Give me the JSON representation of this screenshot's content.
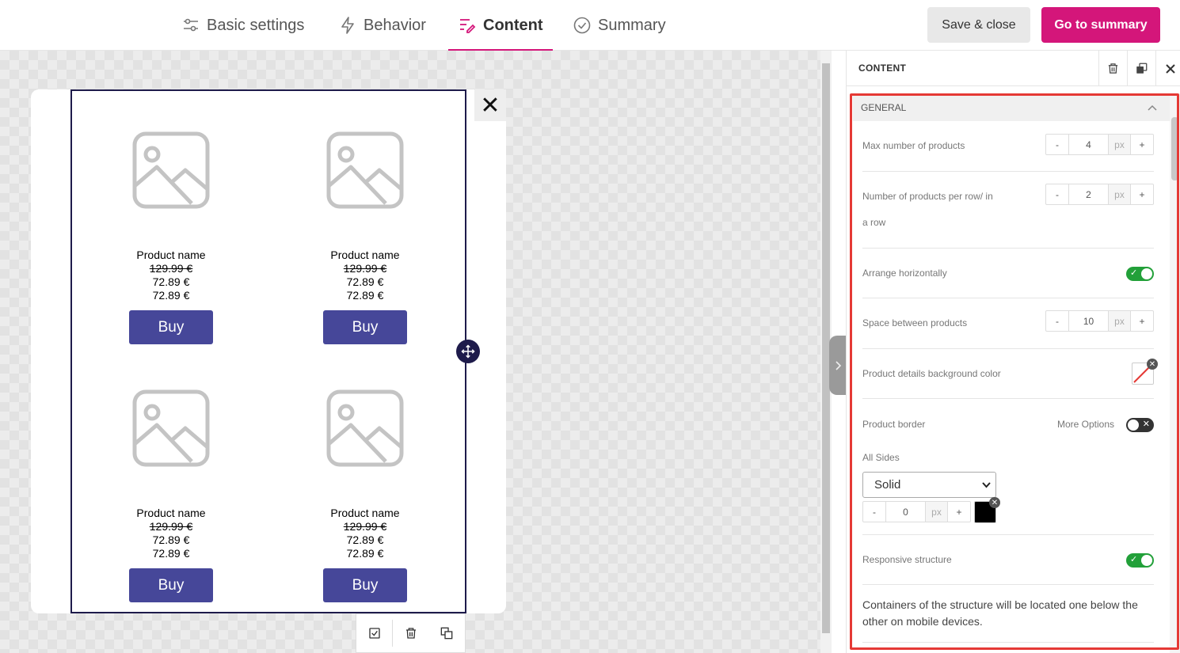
{
  "tabs": [
    {
      "label": "Basic settings",
      "icon": "sliders-icon"
    },
    {
      "label": "Behavior",
      "icon": "lightning-icon"
    },
    {
      "label": "Content",
      "icon": "content-edit-icon",
      "active": true
    },
    {
      "label": "Summary",
      "icon": "check-circle-icon"
    }
  ],
  "actions": {
    "save_close": "Save & close",
    "go_summary": "Go to summary"
  },
  "products": [
    {
      "name": "Product name",
      "old_price": "129.99 €",
      "price1": "72.89 €",
      "price2": "72.89 €",
      "button": "Buy"
    },
    {
      "name": "Product name",
      "old_price": "129.99 €",
      "price1": "72.89 €",
      "price2": "72.89 €",
      "button": "Buy"
    },
    {
      "name": "Product name",
      "old_price": "129.99 €",
      "price1": "72.89 €",
      "price2": "72.89 €",
      "button": "Buy"
    },
    {
      "name": "Product name",
      "old_price": "129.99 €",
      "price1": "72.89 €",
      "price2": "72.89 €",
      "button": "Buy"
    }
  ],
  "panel": {
    "title": "CONTENT",
    "section": "GENERAL",
    "max_products": {
      "label": "Max number of products",
      "value": "4",
      "unit": "px"
    },
    "per_row": {
      "label_line1": "Number of products per row/ in",
      "label_line2": "a row",
      "value": "2",
      "unit": "px"
    },
    "arrange": {
      "label": "Arrange horizontally",
      "on": true
    },
    "space": {
      "label": "Space between products",
      "value": "10",
      "unit": "px"
    },
    "bg_color": {
      "label": "Product details background color"
    },
    "border": {
      "label": "Product border",
      "more": "More Options",
      "on": false,
      "sides_label": "All Sides",
      "style": "Solid",
      "width": "0",
      "unit": "px",
      "color": "#000000"
    },
    "responsive": {
      "label": "Responsive structure",
      "on": true
    },
    "help": "Containers of the structure will be located one below the other on mobile devices."
  },
  "colors": {
    "accent": "#d4167a",
    "buy_button": "#464799",
    "toggle_on": "#22a039",
    "highlight": "#e53935"
  }
}
